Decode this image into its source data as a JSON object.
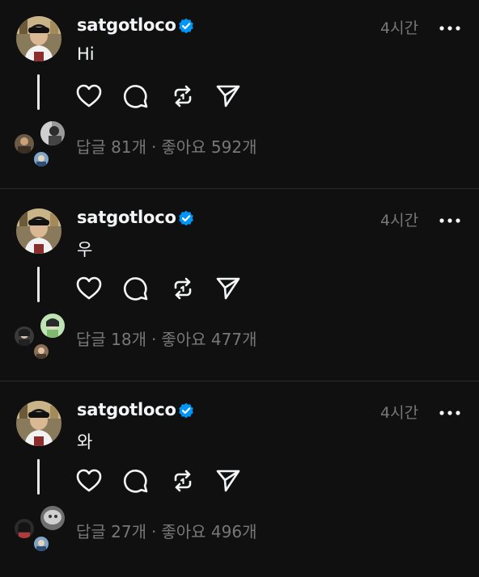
{
  "colors": {
    "background": "#101010",
    "text": "#f3f5f7",
    "muted": "#777777",
    "verified": "#0095f6"
  },
  "posts": [
    {
      "username": "satgotloco",
      "time": "4시간",
      "content": "Hi",
      "replies": "답글 81개",
      "likes": "좋아요 592개"
    },
    {
      "username": "satgotloco",
      "time": "4시간",
      "content": "우",
      "replies": "답글 18개",
      "likes": "좋아요 477개"
    },
    {
      "username": "satgotloco",
      "time": "4시간",
      "content": "와",
      "replies": "답글 27개",
      "likes": "좋아요 496개"
    }
  ],
  "separator": "·",
  "icons": {
    "like": "heart-icon",
    "reply": "comment-bubble-icon",
    "repost": "repost-icon",
    "share": "send-icon",
    "more": "more-horizontal-icon",
    "verified": "verified-badge-icon"
  }
}
